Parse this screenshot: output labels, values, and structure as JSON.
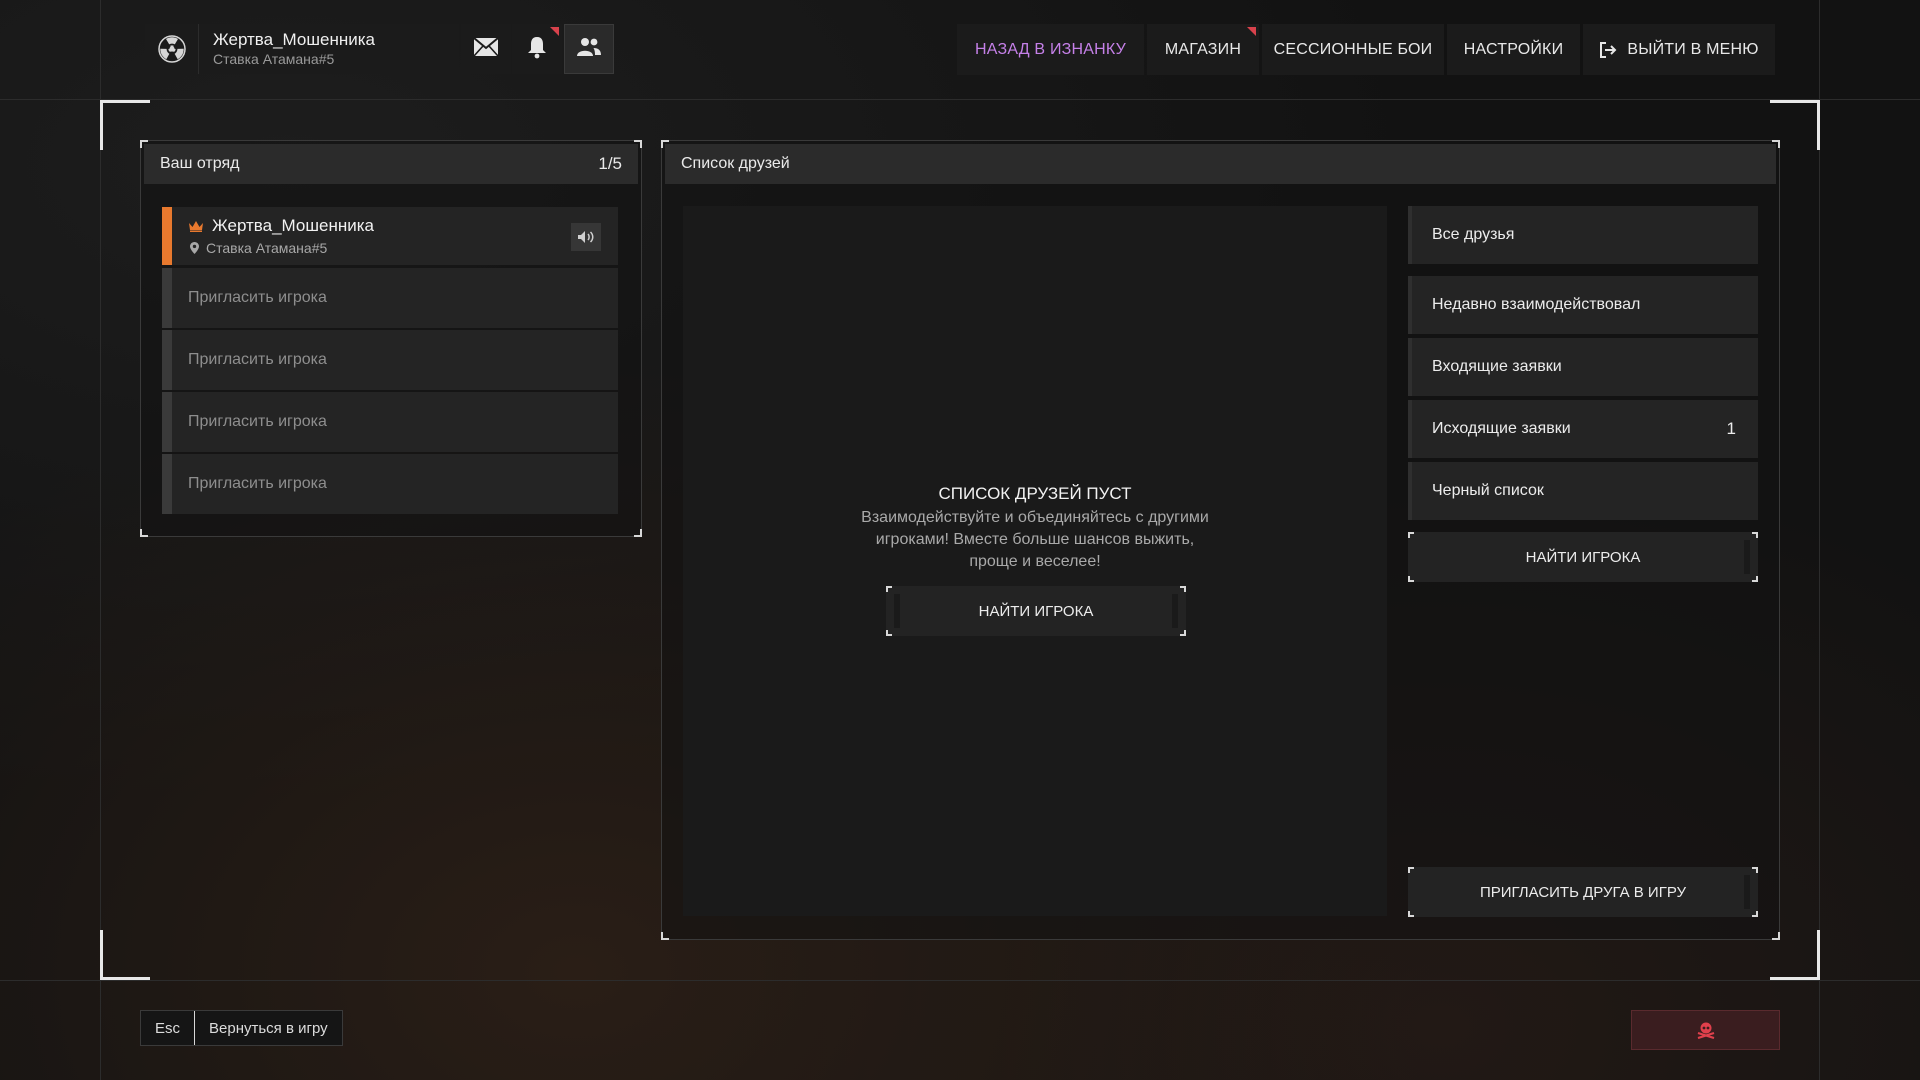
{
  "profile": {
    "name": "Жертва_Мошенника",
    "tag": "Ставка Атамана#5",
    "logo_icon": "radiation-icon"
  },
  "top_icons": [
    {
      "name": "mail-icon"
    },
    {
      "name": "bell-icon",
      "notification": true
    },
    {
      "name": "friends-icon",
      "active": true
    }
  ],
  "nav": {
    "back": "НАЗАД В ИЗНАНКУ",
    "shop": "МАГАЗИН",
    "session": "СЕССИОННЫЕ БОИ",
    "settings": "НАСТРОЙКИ",
    "exit": "ВЫЙТИ В МЕНЮ",
    "accent_color": "#c580e8",
    "alert_color": "#d8424c"
  },
  "squad": {
    "title": "Ваш отряд",
    "count": "1/5",
    "leader": {
      "name": "Жертва_Мошенника",
      "location": "Ставка Атамана#5",
      "accent": "#e8792e"
    },
    "invite_slots": [
      "Пригласить игрока",
      "Пригласить игрока",
      "Пригласить игрока",
      "Пригласить игрока"
    ]
  },
  "friends": {
    "title": "Список друзей",
    "empty_title": "СПИСОК ДРУЗЕЙ ПУСТ",
    "empty_line1": "Взаимодействуйте и объединяйтесь с другими",
    "empty_line2": "игроками! Вместе больше шансов выжить,",
    "empty_line3": "проще и веселее!",
    "find_button": "НАЙТИ ИГРОКА",
    "filters": {
      "all": "Все друзья",
      "recent": "Недавно взаимодействовал",
      "incoming": "Входящие заявки",
      "outgoing": "Исходящие заявки",
      "outgoing_count": "1",
      "blacklist": "Черный список"
    },
    "side_find_button": "НАЙТИ ИГРОКА",
    "invite_button": "ПРИГЛАСИТЬ ДРУГА В ИГРУ"
  },
  "footer": {
    "esc_key": "Esc",
    "back_label": "Вернуться в игру",
    "danger_icon": "skull-icon"
  }
}
